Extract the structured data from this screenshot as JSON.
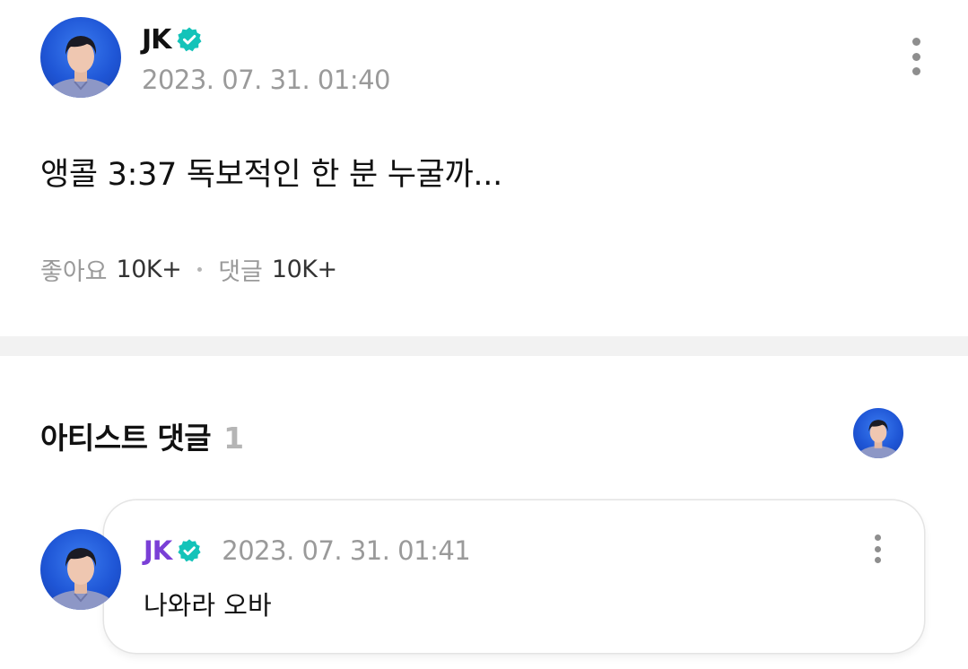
{
  "post": {
    "author": "JK",
    "timestamp": "2023. 07. 31. 01:40",
    "text": "앵콜 3:37 독보적인 한 분 누굴까...",
    "likes_label": "좋아요",
    "likes_count": "10K+",
    "comments_label": "댓글",
    "comments_count": "10K+"
  },
  "artist_comments": {
    "title": "아티스트 댓글",
    "count": "1"
  },
  "comment": {
    "author": "JK",
    "timestamp": "2023. 07. 31. 01:41",
    "text": "나와라 오바"
  },
  "colors": {
    "verified_badge": "#14c3b9",
    "comment_author": "#7a3fd6",
    "muted_text": "#9a9a9a",
    "avatar_background": "#1f56d6"
  },
  "icons": {
    "verified": "verified-badge-icon",
    "more": "more-vertical-icon"
  }
}
